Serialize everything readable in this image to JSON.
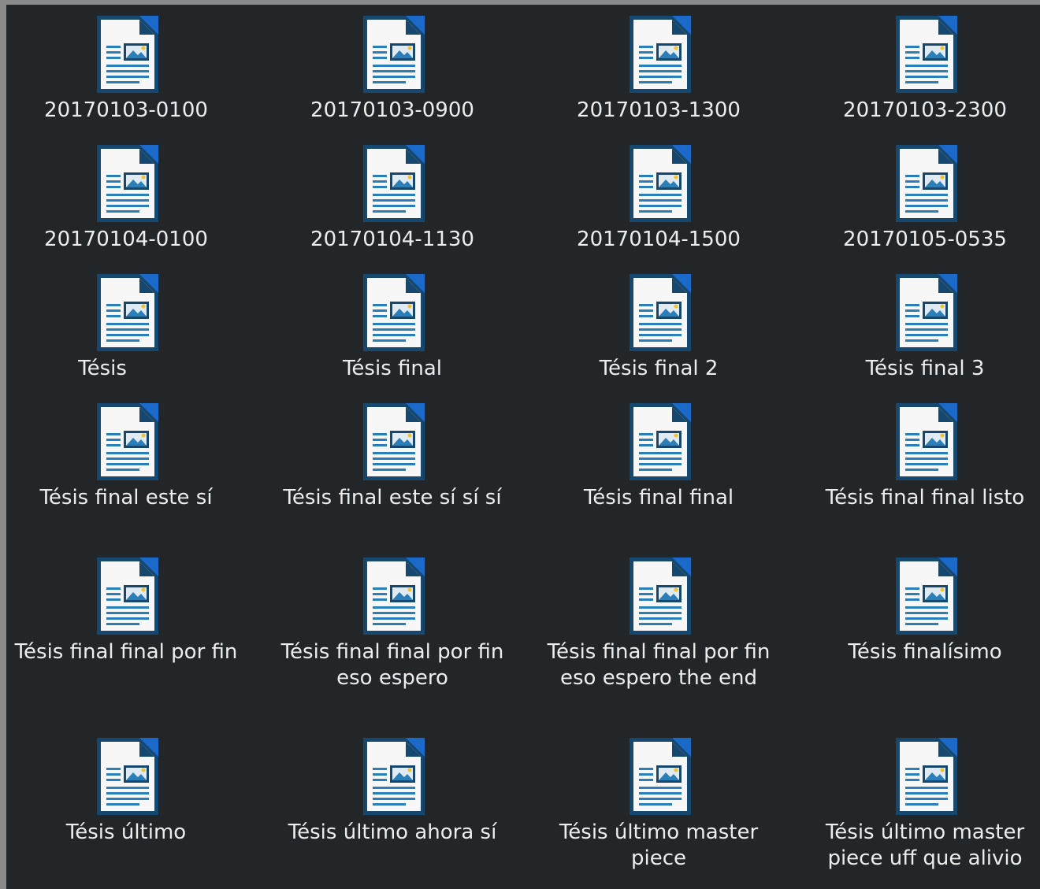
{
  "colors": {
    "background": "#232629",
    "label_text": "#ededed",
    "icon_fold": "#1b6ac9",
    "icon_outline": "#16486f",
    "icon_paper": "#f7f7f7",
    "icon_lines": "#2a7fb8",
    "icon_sun": "#f2c12e"
  },
  "files": [
    {
      "name": "20170103-0100",
      "icon": "writer-document-icon"
    },
    {
      "name": "20170103-0900",
      "icon": "writer-document-icon"
    },
    {
      "name": "20170103-1300",
      "icon": "writer-document-icon"
    },
    {
      "name": "20170103-2300",
      "icon": "writer-document-icon"
    },
    {
      "name": "20170104-0100",
      "icon": "writer-document-icon"
    },
    {
      "name": "20170104-1130",
      "icon": "writer-document-icon"
    },
    {
      "name": "20170104-1500",
      "icon": "writer-document-icon"
    },
    {
      "name": "20170105-0535",
      "icon": "writer-document-icon"
    },
    {
      "name": "Tésis",
      "icon": "writer-document-icon"
    },
    {
      "name": "Tésis final",
      "icon": "writer-document-icon"
    },
    {
      "name": "Tésis final 2",
      "icon": "writer-document-icon"
    },
    {
      "name": "Tésis final 3",
      "icon": "writer-document-icon"
    },
    {
      "name": "Tésis final este sí",
      "icon": "writer-document-icon"
    },
    {
      "name": "Tésis final este sí sí sí",
      "icon": "writer-document-icon"
    },
    {
      "name": "Tésis final final",
      "icon": "writer-document-icon"
    },
    {
      "name": "Tésis final final listo",
      "icon": "writer-document-icon"
    },
    {
      "name": "Tésis final final por fin",
      "icon": "writer-document-icon"
    },
    {
      "name": "Tésis final final por fin eso espero",
      "icon": "writer-document-icon"
    },
    {
      "name": "Tésis final final por fin eso espero the end",
      "icon": "writer-document-icon"
    },
    {
      "name": "Tésis finalísimo",
      "icon": "writer-document-icon"
    },
    {
      "name": "Tésis último",
      "icon": "writer-document-icon"
    },
    {
      "name": "Tésis último ahora sí",
      "icon": "writer-document-icon"
    },
    {
      "name": "Tésis último master piece",
      "icon": "writer-document-icon"
    },
    {
      "name": "Tésis último master piece uff que alivio",
      "icon": "writer-document-icon"
    }
  ]
}
